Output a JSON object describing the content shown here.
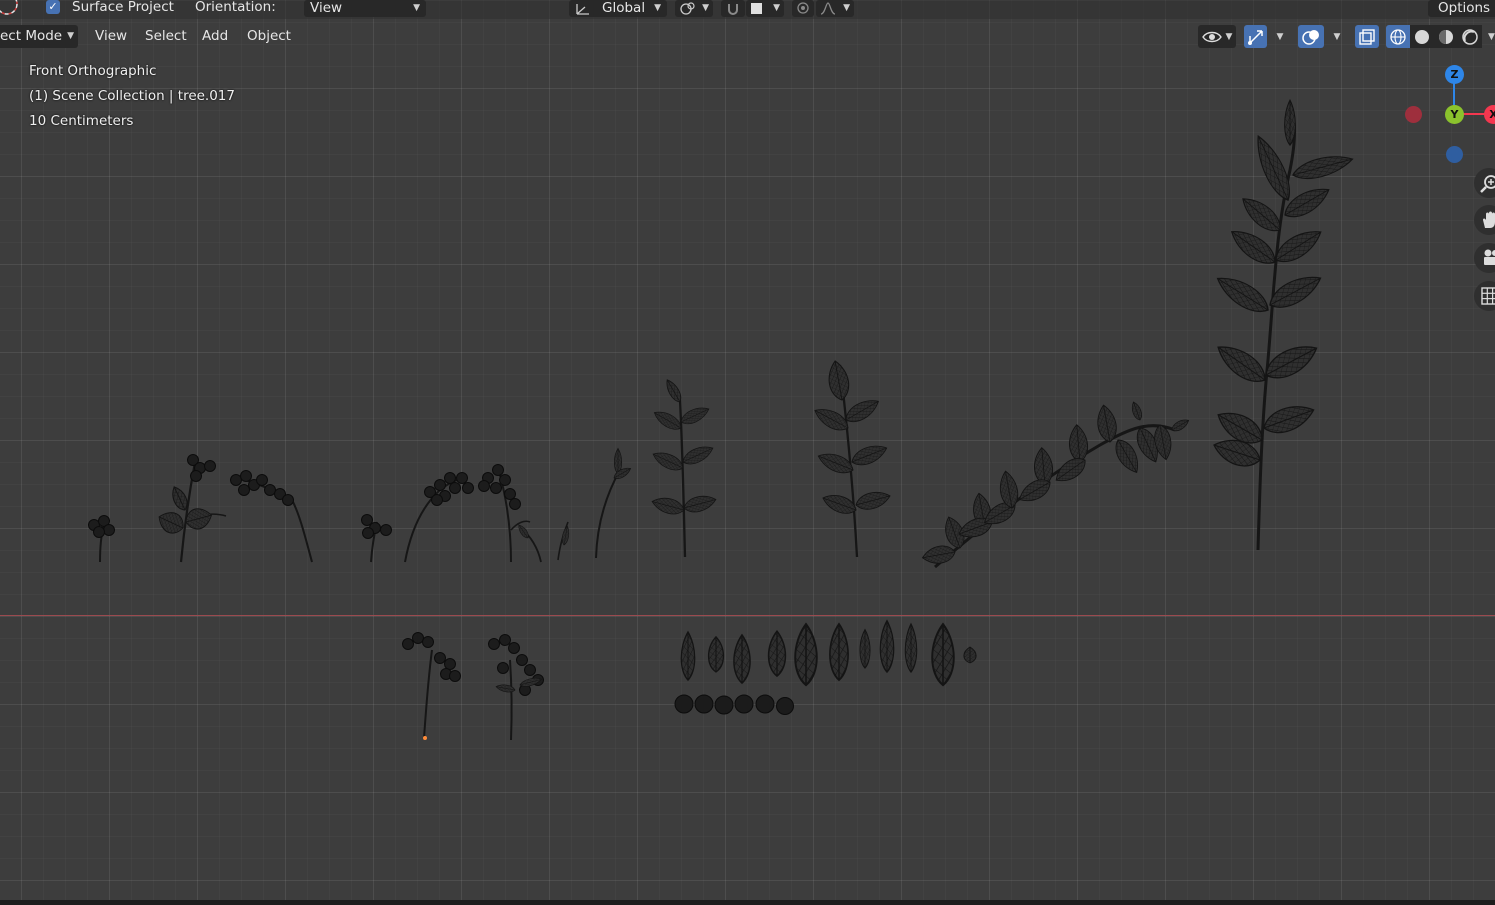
{
  "header": {
    "snap_option_label": "Surface Project",
    "snap_option_checked": true,
    "orientation_label": "Orientation:",
    "orientation_value": "View",
    "transform_orientation": "Global",
    "options_label": "Options"
  },
  "toolbar": {
    "mode": "ect Mode",
    "menus": [
      "View",
      "Select",
      "Add",
      "Object"
    ]
  },
  "overlay": {
    "view_name": "Front Orthographic",
    "collection": "(1) Scene Collection | tree.017",
    "scale": "10 Centimeters"
  },
  "gizmo": {
    "z_label": "Z",
    "y_label": "Y",
    "x_label": "X",
    "colors": {
      "x": "#f5374f",
      "y": "#8bc22d",
      "z": "#2e86e8",
      "neg_x": "#9e2f3d",
      "neg_z": "#2f5ea0"
    }
  },
  "theme": {
    "viewport_bg": "#3d3d3d",
    "accent": "#4772b3",
    "x_axis": "#9b4a4f"
  },
  "icons": {
    "cursor": "3d-cursor-icon",
    "transform": "transform-orientation-icon",
    "pivot": "pivot-point-icon",
    "snap": "snap-magnet-icon",
    "snap_target": "snap-increment-icon",
    "proportional": "proportional-edit-icon",
    "falloff": "falloff-curve-icon",
    "visibility": "eye-icon",
    "gizmos": "gizmo-icon",
    "overlays": "overlays-icon",
    "xray": "xray-icon",
    "wireframe": "wireframe-shading-icon",
    "solid": "solid-shading-icon",
    "material": "material-shading-icon",
    "rendered": "rendered-shading-icon",
    "zoom": "zoom-icon",
    "pan": "hand-icon",
    "camera": "camera-icon",
    "ortho": "grid-ortho-icon"
  }
}
